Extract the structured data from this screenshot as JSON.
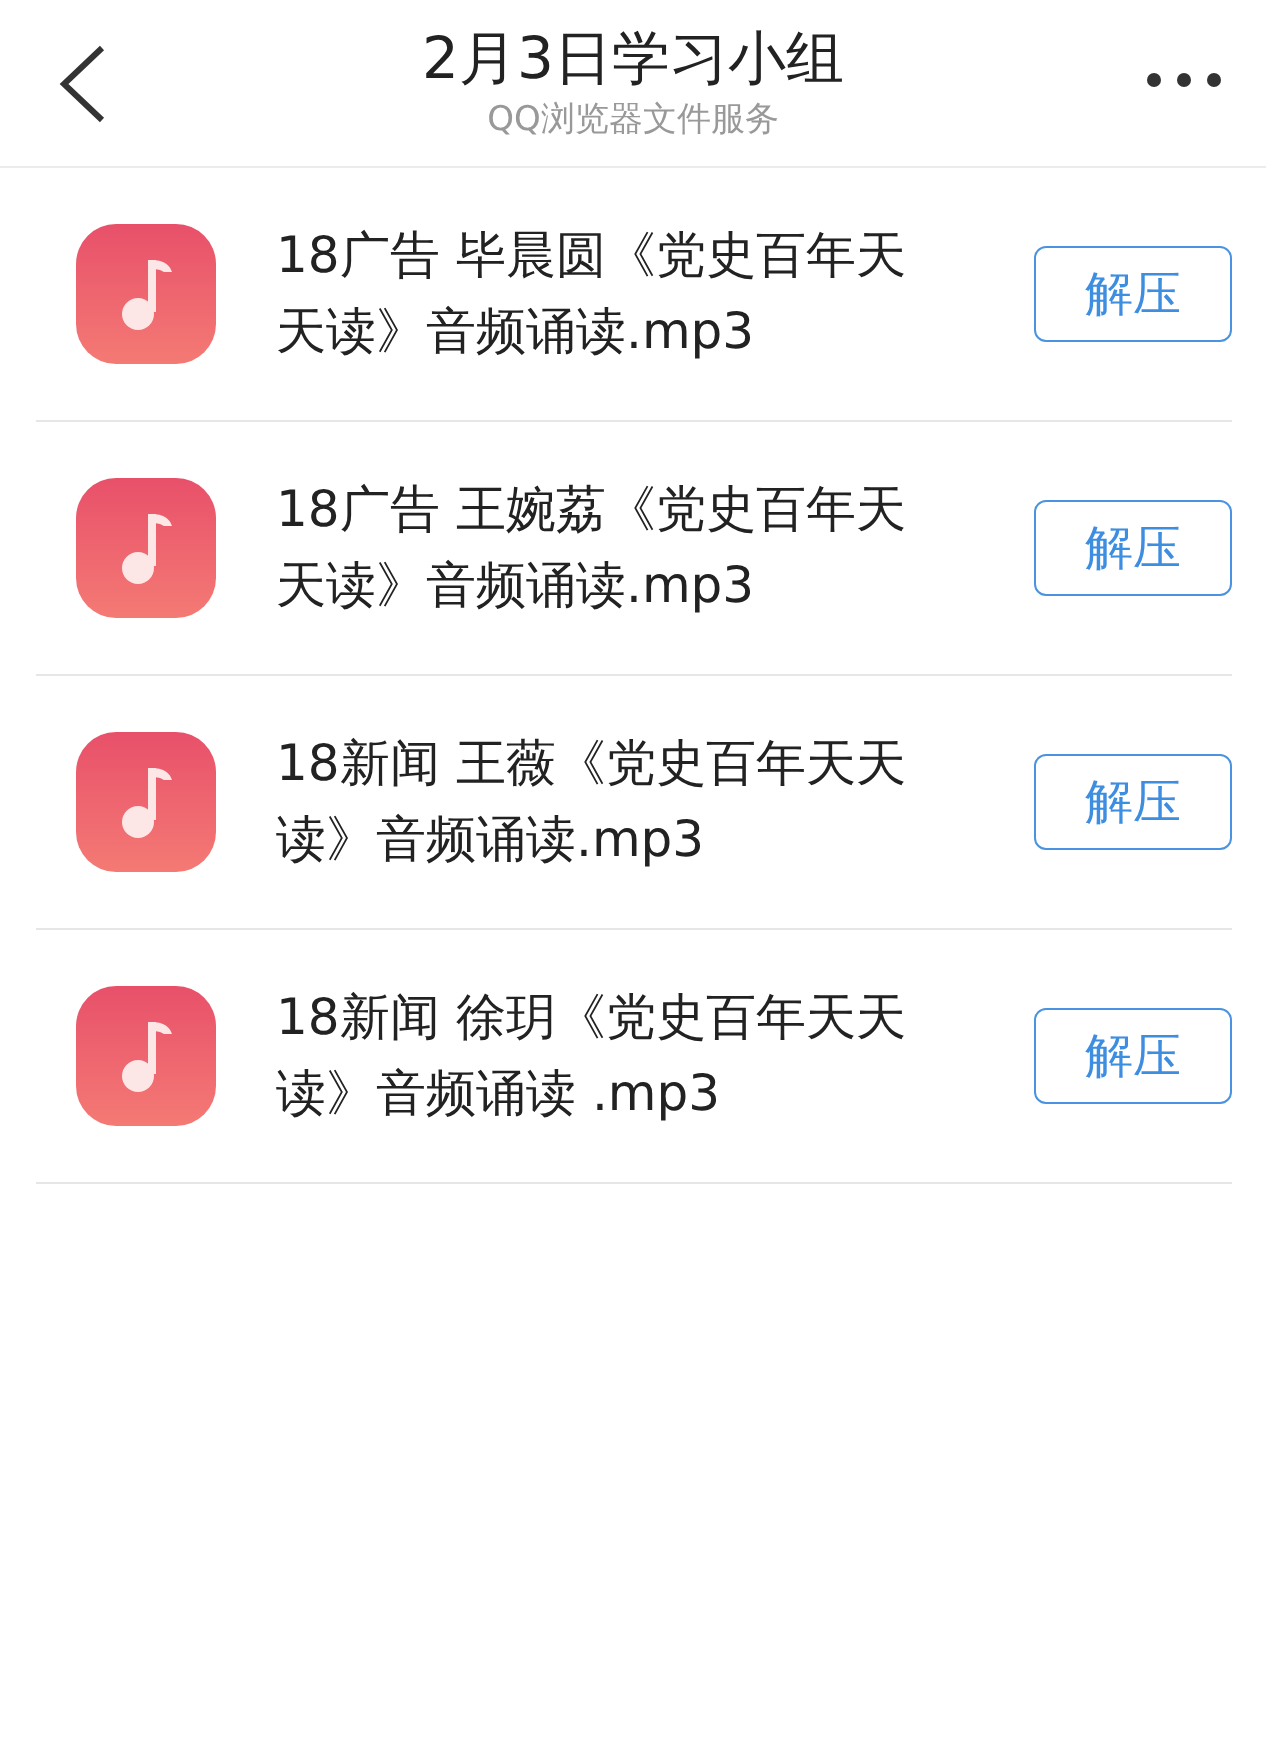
{
  "header": {
    "title": "2月3日学习小组",
    "subtitle": "QQ浏览器文件服务"
  },
  "files": [
    {
      "kind": "audio",
      "name_lines": [
        "18广告 毕晨圆《党史百年天",
        "天读》音频诵读.mp3"
      ],
      "action": "解压"
    },
    {
      "kind": "audio",
      "name_lines": [
        "18广告 王婉荔《党史百年天",
        "天读》音频诵读.mp3"
      ],
      "action": "解压"
    },
    {
      "kind": "audio",
      "name_lines": [
        "18新闻 王薇《党史百年天天",
        "读》音频诵读.mp3"
      ],
      "action": "解压"
    },
    {
      "kind": "audio",
      "name_lines": [
        "18新闻 徐玥《党史百年天天",
        "读》音频诵读 .mp3"
      ],
      "action": "解压"
    }
  ]
}
